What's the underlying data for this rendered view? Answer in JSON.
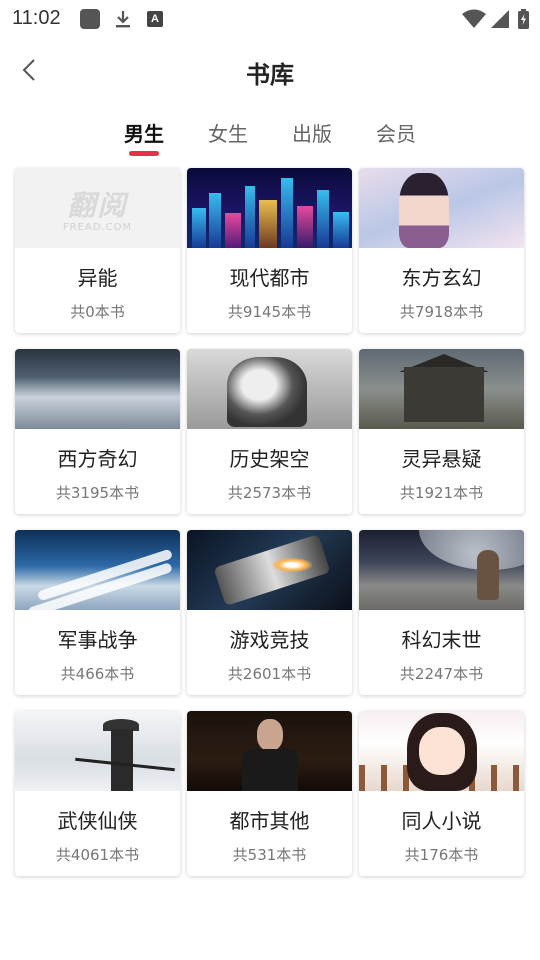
{
  "status_bar": {
    "time": "11:02",
    "icons": [
      "app-square-icon",
      "download-icon",
      "text-a-icon",
      "wifi-icon",
      "signal-icon",
      "battery-icon"
    ]
  },
  "header": {
    "back_icon": "chevron-left-icon",
    "title": "书库"
  },
  "tabs": [
    {
      "label": "男生",
      "active": true
    },
    {
      "label": "女生",
      "active": false
    },
    {
      "label": "出版",
      "active": false
    },
    {
      "label": "会员",
      "active": false
    }
  ],
  "colors": {
    "accent": "#e8304a",
    "text_primary": "#222222",
    "text_secondary": "#777777"
  },
  "cover_logo": {
    "cn": "翻阅",
    "en": "FREAD.COM"
  },
  "categories": [
    {
      "name": "异能",
      "count": "共0本书"
    },
    {
      "name": "现代都市",
      "count": "共9145本书"
    },
    {
      "name": "东方玄幻",
      "count": "共7918本书"
    },
    {
      "name": "西方奇幻",
      "count": "共3195本书"
    },
    {
      "name": "历史架空",
      "count": "共2573本书"
    },
    {
      "name": "灵异悬疑",
      "count": "共1921本书"
    },
    {
      "name": "军事战争",
      "count": "共466本书"
    },
    {
      "name": "游戏竞技",
      "count": "共2601本书"
    },
    {
      "name": "科幻末世",
      "count": "共2247本书"
    },
    {
      "name": "武侠仙侠",
      "count": "共4061本书"
    },
    {
      "name": "都市其他",
      "count": "共531本书"
    },
    {
      "name": "同人小说",
      "count": "共176本书"
    }
  ]
}
